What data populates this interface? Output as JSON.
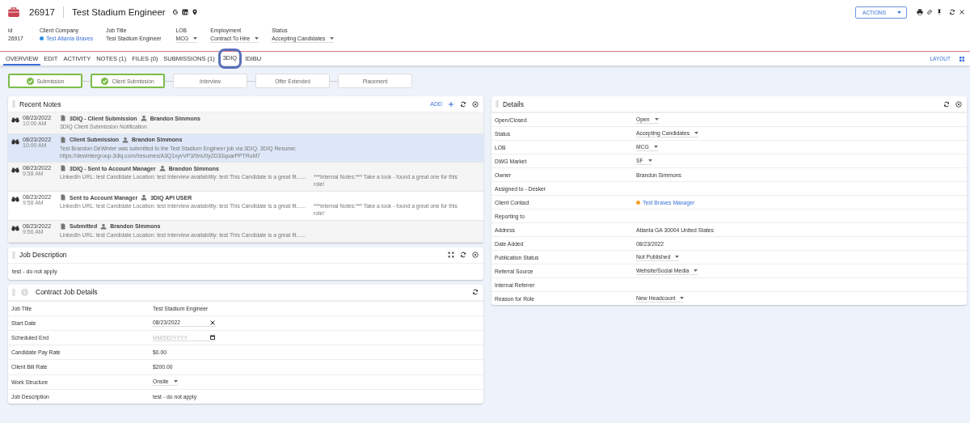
{
  "header": {
    "id": "26917",
    "title": "Test Stadium Engineer",
    "actions": "ACTIONS",
    "fields": [
      {
        "label": "id",
        "value": "26917",
        "kind": "text"
      },
      {
        "label": "Client Company",
        "value": "Test Atlanta Braves",
        "kind": "link",
        "color": "#2f8fe0"
      },
      {
        "label": "Job Title",
        "value": "Test Stadium Engineer",
        "kind": "text"
      },
      {
        "label": "LOB",
        "value": "MCG",
        "kind": "select"
      },
      {
        "label": "Employment",
        "value": "Contract To Hire",
        "kind": "select"
      },
      {
        "label": "Status",
        "value": "Accepting Candidates",
        "kind": "select"
      }
    ]
  },
  "tabs": [
    {
      "label": "OVERVIEW",
      "selected": true,
      "circled": false
    },
    {
      "label": "EDIT",
      "selected": false,
      "circled": false
    },
    {
      "label": "ACTIVITY",
      "selected": false,
      "circled": false
    },
    {
      "label": "NOTES (1)",
      "selected": false,
      "circled": false
    },
    {
      "label": "FILES (0)",
      "selected": false,
      "circled": false
    },
    {
      "label": "SUBMISSIONS (1)",
      "selected": false,
      "circled": false
    },
    {
      "label": "3DIQ",
      "selected": false,
      "circled": true
    },
    {
      "label": "IDIBU",
      "selected": false,
      "circled": false
    }
  ],
  "layout": "LAYOUT",
  "steps": [
    {
      "label": "Submission",
      "done": true
    },
    {
      "label": "Client Submission",
      "done": true
    },
    {
      "label": "Interview",
      "done": false
    },
    {
      "label": "Offer Extended",
      "done": false
    },
    {
      "label": "Placement",
      "done": false
    }
  ],
  "recent_notes": {
    "title": "Recent Notes",
    "add": "ADD",
    "notes": [
      {
        "date": "08/23/2022",
        "time": "10:00 AM",
        "subject": "3DIQ - Client Submission",
        "author": "Brandon Simmons",
        "text": "3DIQ Client Submission Notification",
        "selected": false
      },
      {
        "date": "08/23/2022",
        "time": "10:00 AM",
        "subject": "Client Submission",
        "author": "Brandon Simmons",
        "text": "Test Brandon DeWinter was submitted to the Test Stadium Engineer job via 3DIQ. 3DIQ Resume: https://dewintergroup.3diq.com//resumes/A3Q1xyvVP3/9nU0y2D33quarPPTRuM7",
        "selected": true
      },
      {
        "date": "08/23/2022",
        "time": "9:58 AM",
        "subject": "3DIQ - Sent to Account Manager",
        "author": "Brandon Simmons",
        "text": "LinkedIn URL: test Candidate Location: test Interview availability: test This Candidate is a great fit......",
        "internal": "***Internal Notes:*** Take a look - found a great one for this role!",
        "selected": false
      },
      {
        "date": "08/23/2022",
        "time": "9:58 AM",
        "subject": "Sent to Account Manager",
        "author": "3DIQ API USER",
        "text": "LinkedIn URL: test Candidate Location: test Interview availability: test This Candidate is a great fit......",
        "internal": "***Internal Notes:*** Take a look - found a great one for this role!",
        "selected": false
      },
      {
        "date": "08/23/2022",
        "time": "9:56 AM",
        "subject": "Submitted",
        "author": "Brandon Simmons",
        "text": "LinkedIn URL: test Candidate Location: test Interview availability: test This Candidate is a great fit......",
        "selected": false
      }
    ]
  },
  "job_description": {
    "title": "Job Description",
    "text": "test - do not apply"
  },
  "contract_job_details": {
    "title": "Contract Job Details",
    "rows": [
      {
        "label": "Job Title",
        "value": "Test Stadium Engineer",
        "kind": "text"
      },
      {
        "label": "Start Date",
        "value": "08/23/2022",
        "kind": "date"
      },
      {
        "label": "Scheduled End",
        "placeholder": "MM/DD/YYYY",
        "kind": "date"
      },
      {
        "label": "Candidate Pay Rate",
        "value": "$0.00",
        "kind": "text"
      },
      {
        "label": "Client Bill Rate",
        "value": "$200.00",
        "kind": "text"
      },
      {
        "label": "Work Structure",
        "value": "Onsite",
        "kind": "select"
      },
      {
        "label": "Job Description",
        "value": "test - do not apply",
        "kind": "text"
      }
    ]
  },
  "details": {
    "title": "Details",
    "rows": [
      {
        "label": "Open/Closed",
        "value": "Open",
        "kind": "select"
      },
      {
        "label": "Status",
        "value": "Accepting Candidates",
        "kind": "select"
      },
      {
        "label": "LOB",
        "value": "MCG",
        "kind": "select"
      },
      {
        "label": "DWG Market",
        "value": "SF",
        "kind": "select"
      },
      {
        "label": "Owner",
        "value": "Brandon Simmons",
        "kind": "text"
      },
      {
        "label": "Assigned to - Desker",
        "kind": "empty"
      },
      {
        "label": "Client Contact",
        "value": "Test Braves Manager",
        "kind": "link",
        "color": "#f5a030"
      },
      {
        "label": "Reporting to",
        "kind": "empty"
      },
      {
        "label": "Address",
        "value": "Atlanta GA 30004 United States",
        "kind": "text"
      },
      {
        "label": "Date Added",
        "value": "08/23/2022",
        "kind": "text"
      },
      {
        "label": "Publication Status",
        "value": "Not Published",
        "kind": "select"
      },
      {
        "label": "Referral Source",
        "value": "Website/Social Media",
        "kind": "select"
      },
      {
        "label": "Internal Referrer",
        "kind": "empty"
      },
      {
        "label": "Reason for Role",
        "value": "New Headcount",
        "kind": "select"
      }
    ]
  }
}
